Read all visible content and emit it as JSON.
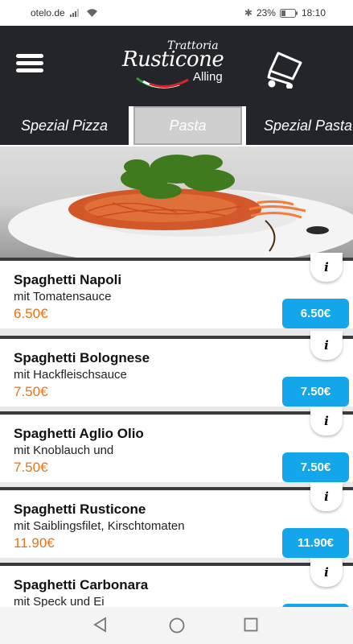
{
  "status": {
    "carrier": "otelo.de",
    "battery": "23%",
    "time": "18:10"
  },
  "header": {
    "logo_line1": "Trattoria",
    "logo_line2": "Rusticone",
    "logo_line3": "Alling",
    "menu_icon": "hamburger-icon",
    "cart_icon": "cart-icon"
  },
  "tabs": [
    {
      "label": "Spezial Pizza"
    },
    {
      "label": "Pasta"
    },
    {
      "label": "Spezial Pasta"
    }
  ],
  "items": [
    {
      "name": "Spaghetti Napoli",
      "desc": "mit Tomatensauce",
      "price": "6.50€",
      "button": "6.50€",
      "info": "i"
    },
    {
      "name": "Spaghetti Bolognese",
      "desc": "mit Hackfleischsauce",
      "price": "7.50€",
      "button": "7.50€",
      "info": "i"
    },
    {
      "name": "Spaghetti Aglio Olio",
      "desc": "mit Knoblauch und",
      "price": "7.50€",
      "button": "7.50€",
      "info": "i"
    },
    {
      "name": "Spaghetti Rusticone",
      "desc": "mit Saiblingsfilet, Kirschtomaten",
      "price": "11.90€",
      "button": "11.90€",
      "info": "i"
    },
    {
      "name": "Spaghetti Carbonara",
      "desc": "mit Speck und Ei",
      "price": "",
      "button": "",
      "info": "i"
    }
  ],
  "colors": {
    "header_bg": "#24252a",
    "price_orange": "#e8731b",
    "button_blue": "#14a6ea"
  },
  "navbar": {
    "back_icon": "back-triangle-icon",
    "home_icon": "home-circle-icon",
    "recents_icon": "recents-square-icon"
  }
}
